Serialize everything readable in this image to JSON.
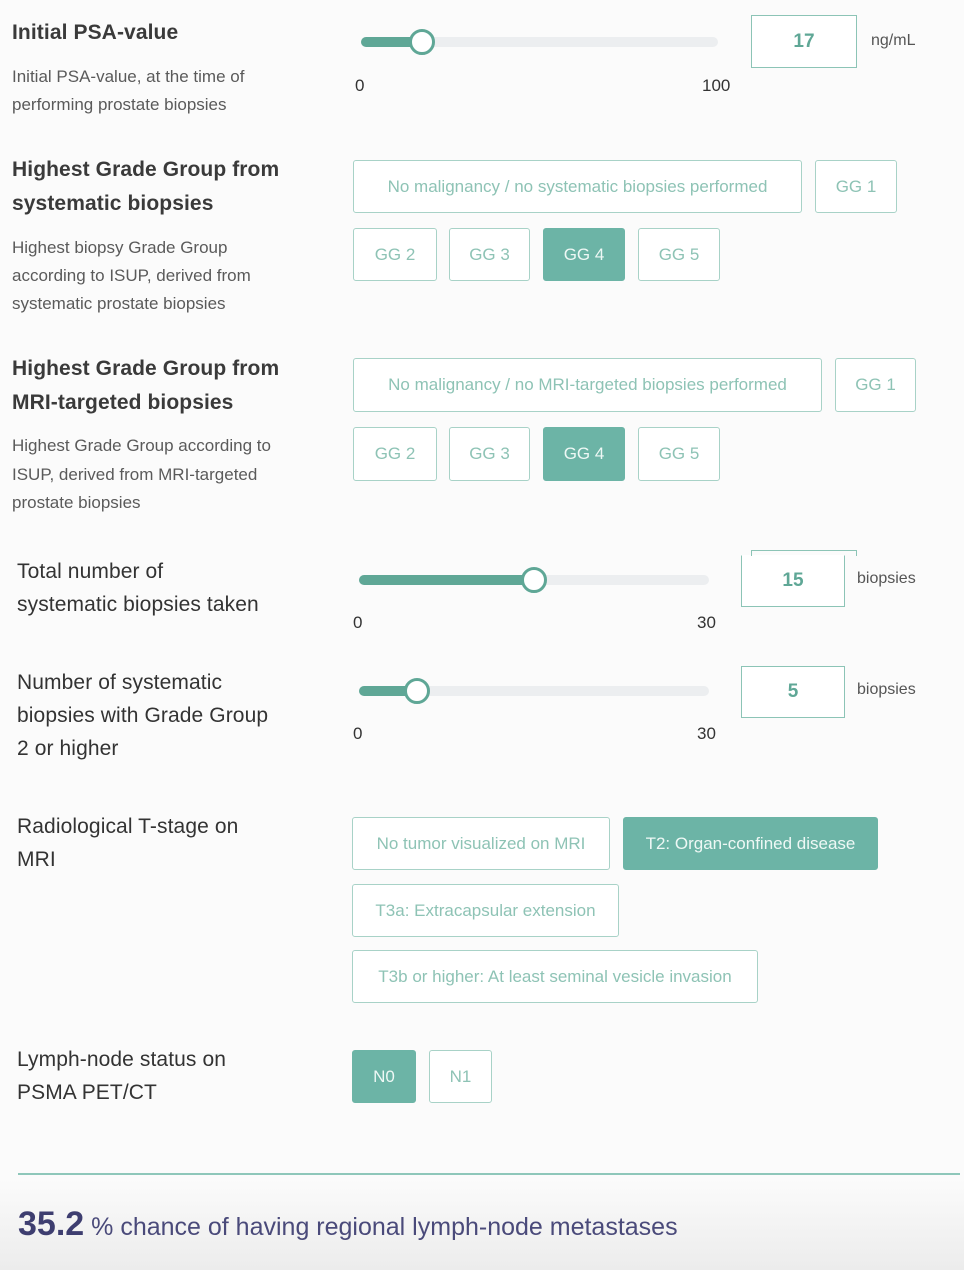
{
  "psa": {
    "title": "Initial PSA-value",
    "description_line1": "Initial PSA-value, at the time of",
    "description_line2": "performing prostate biopsies",
    "value": "17",
    "min": "0",
    "max": "100",
    "fraction": 0.17,
    "unit": "ng/mL"
  },
  "gg_systematic": {
    "title_line1": "Highest Grade Group from",
    "title_line2": "systematic biopsies",
    "description_line1": "Highest biopsy Grade Group",
    "description_line2": "according to ISUP, derived from",
    "description_line3": "systematic prostate biopsies",
    "options": [
      "No malignancy / no systematic biopsies performed",
      "GG 1",
      "GG 2",
      "GG 3",
      "GG 4",
      "GG 5"
    ],
    "selected": "GG 4"
  },
  "gg_mri": {
    "title_line1": "Highest Grade Group from",
    "title_line2": "MRI-targeted biopsies",
    "description_line1": "Highest Grade Group according to",
    "description_line2": "ISUP, derived from MRI-targeted",
    "description_line3": "prostate biopsies",
    "options": [
      "No malignancy / no MRI-targeted biopsies performed",
      "GG 1",
      "GG 2",
      "GG 3",
      "GG 4",
      "GG 5"
    ],
    "selected": "GG 4"
  },
  "total_biopsies": {
    "title_line1": "Total number of",
    "title_line2": "systematic biopsies taken",
    "value": "15",
    "min": "0",
    "max": "30",
    "fraction": 0.5,
    "unit": "biopsies"
  },
  "gg2_biopsies": {
    "title_line1": "Number of systematic",
    "title_line2": "biopsies with Grade Group",
    "title_line3": "2 or higher",
    "value": "5",
    "min": "0",
    "max": "30",
    "fraction": 0.1667,
    "unit": "biopsies"
  },
  "t_stage": {
    "title_line1": "Radiological T-stage on",
    "title_line2": "MRI",
    "options": [
      "No tumor visualized on MRI",
      "T2: Organ-confined disease",
      "T3a: Extracapsular extension",
      "T3b or higher: At least seminal vesicle invasion"
    ],
    "selected": "T2: Organ-confined disease"
  },
  "lymph_node": {
    "title_line1": "Lymph-node status on",
    "title_line2": "PSMA PET/CT",
    "options": [
      "N0",
      "N1"
    ],
    "selected": "N0"
  },
  "result": {
    "value": "35.2",
    "text": "% chance of having regional lymph-node metastases"
  },
  "colors": {
    "accent": "#6cb4a6",
    "slider": "#5fa796",
    "result_text": "#3e3e70"
  }
}
